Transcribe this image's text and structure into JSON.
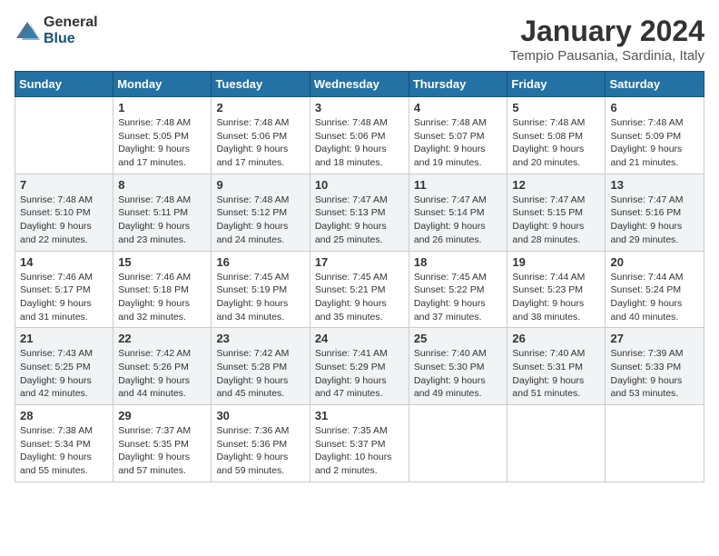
{
  "logo": {
    "general": "General",
    "blue": "Blue"
  },
  "title": "January 2024",
  "location": "Tempio Pausania, Sardinia, Italy",
  "weekdays": [
    "Sunday",
    "Monday",
    "Tuesday",
    "Wednesday",
    "Thursday",
    "Friday",
    "Saturday"
  ],
  "weeks": [
    [
      {
        "day": "",
        "info": ""
      },
      {
        "day": "1",
        "info": "Sunrise: 7:48 AM\nSunset: 5:05 PM\nDaylight: 9 hours\nand 17 minutes."
      },
      {
        "day": "2",
        "info": "Sunrise: 7:48 AM\nSunset: 5:06 PM\nDaylight: 9 hours\nand 17 minutes."
      },
      {
        "day": "3",
        "info": "Sunrise: 7:48 AM\nSunset: 5:06 PM\nDaylight: 9 hours\nand 18 minutes."
      },
      {
        "day": "4",
        "info": "Sunrise: 7:48 AM\nSunset: 5:07 PM\nDaylight: 9 hours\nand 19 minutes."
      },
      {
        "day": "5",
        "info": "Sunrise: 7:48 AM\nSunset: 5:08 PM\nDaylight: 9 hours\nand 20 minutes."
      },
      {
        "day": "6",
        "info": "Sunrise: 7:48 AM\nSunset: 5:09 PM\nDaylight: 9 hours\nand 21 minutes."
      }
    ],
    [
      {
        "day": "7",
        "info": "Sunrise: 7:48 AM\nSunset: 5:10 PM\nDaylight: 9 hours\nand 22 minutes."
      },
      {
        "day": "8",
        "info": "Sunrise: 7:48 AM\nSunset: 5:11 PM\nDaylight: 9 hours\nand 23 minutes."
      },
      {
        "day": "9",
        "info": "Sunrise: 7:48 AM\nSunset: 5:12 PM\nDaylight: 9 hours\nand 24 minutes."
      },
      {
        "day": "10",
        "info": "Sunrise: 7:47 AM\nSunset: 5:13 PM\nDaylight: 9 hours\nand 25 minutes."
      },
      {
        "day": "11",
        "info": "Sunrise: 7:47 AM\nSunset: 5:14 PM\nDaylight: 9 hours\nand 26 minutes."
      },
      {
        "day": "12",
        "info": "Sunrise: 7:47 AM\nSunset: 5:15 PM\nDaylight: 9 hours\nand 28 minutes."
      },
      {
        "day": "13",
        "info": "Sunrise: 7:47 AM\nSunset: 5:16 PM\nDaylight: 9 hours\nand 29 minutes."
      }
    ],
    [
      {
        "day": "14",
        "info": "Sunrise: 7:46 AM\nSunset: 5:17 PM\nDaylight: 9 hours\nand 31 minutes."
      },
      {
        "day": "15",
        "info": "Sunrise: 7:46 AM\nSunset: 5:18 PM\nDaylight: 9 hours\nand 32 minutes."
      },
      {
        "day": "16",
        "info": "Sunrise: 7:45 AM\nSunset: 5:19 PM\nDaylight: 9 hours\nand 34 minutes."
      },
      {
        "day": "17",
        "info": "Sunrise: 7:45 AM\nSunset: 5:21 PM\nDaylight: 9 hours\nand 35 minutes."
      },
      {
        "day": "18",
        "info": "Sunrise: 7:45 AM\nSunset: 5:22 PM\nDaylight: 9 hours\nand 37 minutes."
      },
      {
        "day": "19",
        "info": "Sunrise: 7:44 AM\nSunset: 5:23 PM\nDaylight: 9 hours\nand 38 minutes."
      },
      {
        "day": "20",
        "info": "Sunrise: 7:44 AM\nSunset: 5:24 PM\nDaylight: 9 hours\nand 40 minutes."
      }
    ],
    [
      {
        "day": "21",
        "info": "Sunrise: 7:43 AM\nSunset: 5:25 PM\nDaylight: 9 hours\nand 42 minutes."
      },
      {
        "day": "22",
        "info": "Sunrise: 7:42 AM\nSunset: 5:26 PM\nDaylight: 9 hours\nand 44 minutes."
      },
      {
        "day": "23",
        "info": "Sunrise: 7:42 AM\nSunset: 5:28 PM\nDaylight: 9 hours\nand 45 minutes."
      },
      {
        "day": "24",
        "info": "Sunrise: 7:41 AM\nSunset: 5:29 PM\nDaylight: 9 hours\nand 47 minutes."
      },
      {
        "day": "25",
        "info": "Sunrise: 7:40 AM\nSunset: 5:30 PM\nDaylight: 9 hours\nand 49 minutes."
      },
      {
        "day": "26",
        "info": "Sunrise: 7:40 AM\nSunset: 5:31 PM\nDaylight: 9 hours\nand 51 minutes."
      },
      {
        "day": "27",
        "info": "Sunrise: 7:39 AM\nSunset: 5:33 PM\nDaylight: 9 hours\nand 53 minutes."
      }
    ],
    [
      {
        "day": "28",
        "info": "Sunrise: 7:38 AM\nSunset: 5:34 PM\nDaylight: 9 hours\nand 55 minutes."
      },
      {
        "day": "29",
        "info": "Sunrise: 7:37 AM\nSunset: 5:35 PM\nDaylight: 9 hours\nand 57 minutes."
      },
      {
        "day": "30",
        "info": "Sunrise: 7:36 AM\nSunset: 5:36 PM\nDaylight: 9 hours\nand 59 minutes."
      },
      {
        "day": "31",
        "info": "Sunrise: 7:35 AM\nSunset: 5:37 PM\nDaylight: 10 hours\nand 2 minutes."
      },
      {
        "day": "",
        "info": ""
      },
      {
        "day": "",
        "info": ""
      },
      {
        "day": "",
        "info": ""
      }
    ]
  ]
}
